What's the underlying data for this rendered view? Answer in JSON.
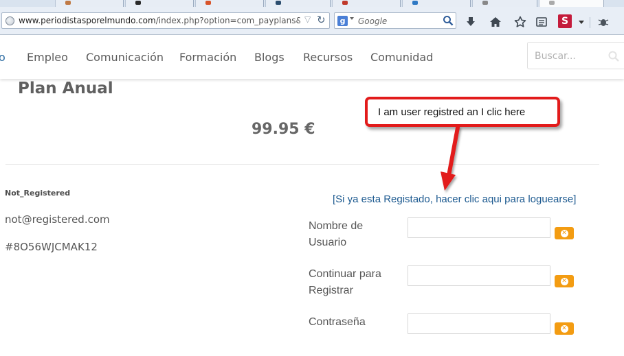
{
  "browser": {
    "url_host": "www.periodistasporelmundo.com",
    "url_path": "/index.php?option=com_payplans&view=ir",
    "search_engine_placeholder": "Google",
    "icons": [
      "globe-icon",
      "url-dropdown-icon",
      "reload-icon",
      "google-icon",
      "search-icon",
      "download-icon",
      "home-icon",
      "star-icon",
      "reading-list-icon",
      "s-addon-icon",
      "menu-dropdown-icon",
      "bug-icon"
    ],
    "addon_letter": "S",
    "colors": {
      "chrome": "#e8eef6",
      "addon": "#c41b3b"
    }
  },
  "site_nav": {
    "partial_item": "o",
    "items": [
      "Empleo",
      "Comunicación",
      "Formación",
      "Blogs",
      "Recursos",
      "Comunidad"
    ],
    "search_placeholder": "Buscar..."
  },
  "plan": {
    "title": "Plan Anual",
    "price": "99.95 €"
  },
  "user": {
    "name": "Not_Registered",
    "email": "not@registered.com",
    "key": "#8O56WJCMAK12"
  },
  "login_link": "[Si ya esta Registado, hacer clic aqui para loguearse]",
  "form": {
    "fields": [
      {
        "label_line1": "Nombre de",
        "label_line2": "Usuario",
        "value": ""
      },
      {
        "label_line1": "Continuar para",
        "label_line2": "Registrar",
        "value": ""
      },
      {
        "label_line1": "Contraseña",
        "label_line2": "",
        "value": ""
      }
    ],
    "clear_icon": "clear-circle-icon",
    "colors": {
      "clear_button": "#f39c12"
    }
  },
  "annotation": {
    "text": "I am user registred an I clic here",
    "colors": {
      "border": "#e21b1b",
      "arrow": "#e21b1b"
    }
  }
}
